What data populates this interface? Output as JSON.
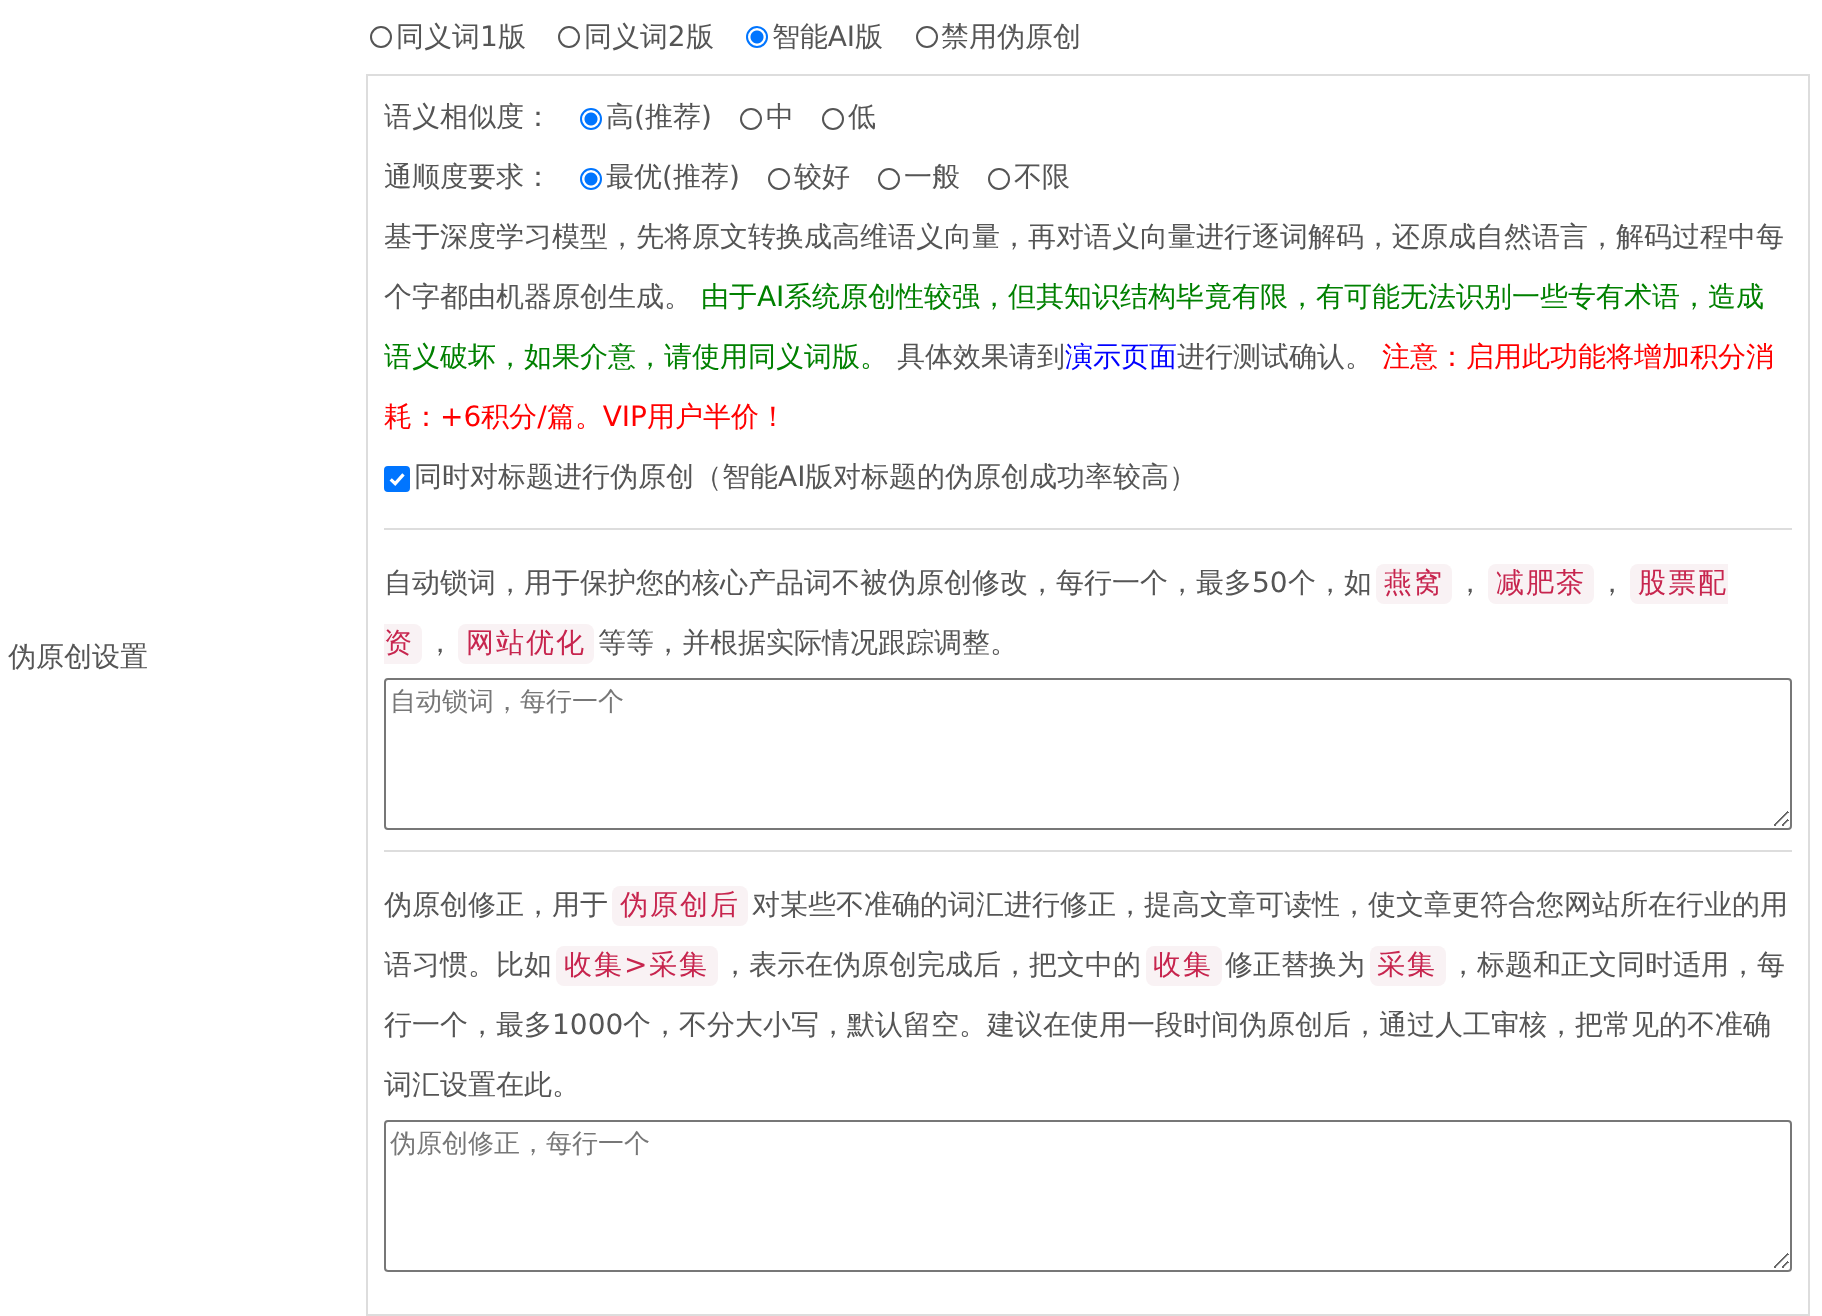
{
  "sidebar_label": "伪原创设置",
  "mode_options": [
    {
      "label": "同义词1版",
      "selected": false
    },
    {
      "label": "同义词2版",
      "selected": false
    },
    {
      "label": "智能AI版",
      "selected": true
    },
    {
      "label": "禁用伪原创",
      "selected": false
    }
  ],
  "similarity": {
    "label": "语义相似度：",
    "options": [
      {
        "label": "高(推荐)",
        "selected": true
      },
      {
        "label": "中",
        "selected": false
      },
      {
        "label": "低",
        "selected": false
      }
    ]
  },
  "fluency": {
    "label": "通顺度要求：",
    "options": [
      {
        "label": "最优(推荐)",
        "selected": true
      },
      {
        "label": "较好",
        "selected": false
      },
      {
        "label": "一般",
        "selected": false
      },
      {
        "label": "不限",
        "selected": false
      }
    ]
  },
  "ai_description": [
    {
      "kind": "text",
      "text": "基于深度学习模型，先将原文转换成高维语义向量，再对语义向量进行逐词解码，还原成自然语言，解码过程中每个字都由机器原创生成。 "
    },
    {
      "kind": "success",
      "text": "由于AI系统原创性较强，但其知识结构毕竟有限，有可能无法识别一些专有术语，造成语义破坏，如果介意，请使用同义词版。"
    },
    {
      "kind": "text",
      "text": " 具体效果请到"
    },
    {
      "kind": "link",
      "text": "演示页面"
    },
    {
      "kind": "text",
      "text": "进行测试确认。 "
    },
    {
      "kind": "warning",
      "text": "注意：启用此功能将增加积分消耗：+6积分/篇。VIP用户半价！"
    }
  ],
  "title_checkbox": {
    "label": "同时对标题进行伪原创（智能AI版对标题的伪原创成功率较高）",
    "checked": true
  },
  "lock_words": {
    "description": [
      {
        "kind": "text",
        "text": "自动锁词，用于保护您的核心产品词不被伪原创修改，每行一个，最多50个，如"
      },
      {
        "kind": "code",
        "text": "燕窝"
      },
      {
        "kind": "text",
        "text": "，"
      },
      {
        "kind": "code",
        "text": "减肥茶"
      },
      {
        "kind": "text",
        "text": "，"
      },
      {
        "kind": "code",
        "text": "股票配资"
      },
      {
        "kind": "text",
        "text": "，"
      },
      {
        "kind": "code",
        "text": "网站优化"
      },
      {
        "kind": "text",
        "text": "等等，并根据实际情况跟踪调整。"
      }
    ],
    "placeholder": "自动锁词，每行一个"
  },
  "correction": {
    "description": [
      {
        "kind": "text",
        "text": "伪原创修正，用于"
      },
      {
        "kind": "code",
        "text": "伪原创后"
      },
      {
        "kind": "text",
        "text": "对某些不准确的词汇进行修正，提高文章可读性，使文章更符合您网站所在行业的用语习惯。比如"
      },
      {
        "kind": "code",
        "text": "收集>采集"
      },
      {
        "kind": "text",
        "text": "，表示在伪原创完成后，把文中的"
      },
      {
        "kind": "code",
        "text": "收集"
      },
      {
        "kind": "text",
        "text": "修正替换为"
      },
      {
        "kind": "code",
        "text": "采集"
      },
      {
        "kind": "text",
        "text": "，标题和正文同时适用，每行一个，最多1000个，不分大小写，默认留空。建议在使用一段时间伪原创后，通过人工审核，把常见的不准确词汇设置在此。"
      }
    ],
    "placeholder": "伪原创修正，每行一个"
  }
}
